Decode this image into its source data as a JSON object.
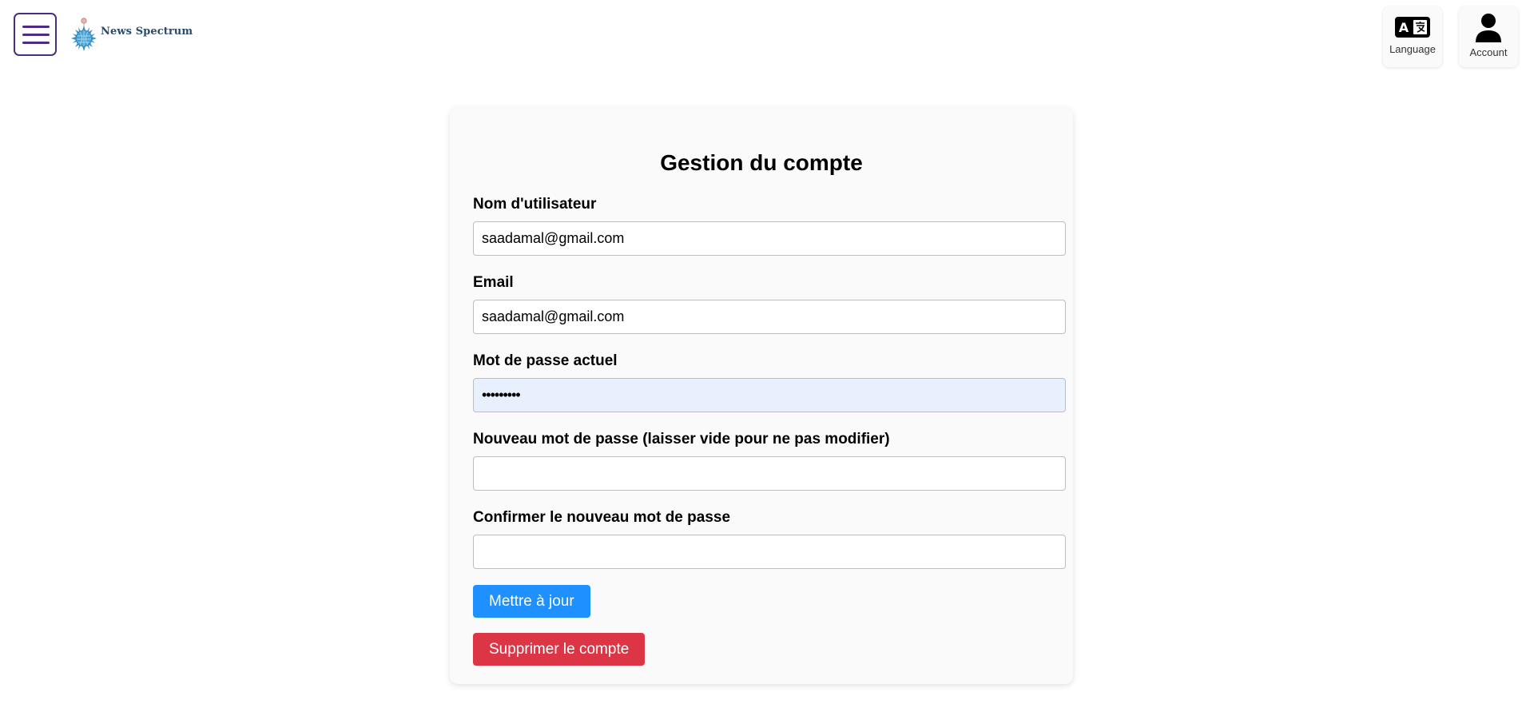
{
  "header": {
    "brand_name": "News Spectrum",
    "language_label": "Language",
    "account_label": "Account"
  },
  "form": {
    "title": "Gestion du compte",
    "username_label": "Nom d'utilisateur",
    "username_value": "saadamal@gmail.com",
    "email_label": "Email",
    "email_value": "saadamal@gmail.com",
    "current_password_label": "Mot de passe actuel",
    "current_password_value": "•••••••••",
    "new_password_label": "Nouveau mot de passe (laisser vide pour ne pas modifier)",
    "new_password_value": "",
    "confirm_password_label": "Confirmer le nouveau mot de passe",
    "confirm_password_value": "",
    "update_button": "Mettre à jour",
    "delete_button": "Supprimer le compte"
  },
  "colors": {
    "menu_accent": "#4b2d83",
    "update_button": "#1e90ff",
    "delete_button": "#dc3545",
    "autofill_background": "#e8f0fe"
  },
  "icons": {
    "menu": "hamburger-menu-icon",
    "language": "translate-icon",
    "account": "person-icon"
  }
}
